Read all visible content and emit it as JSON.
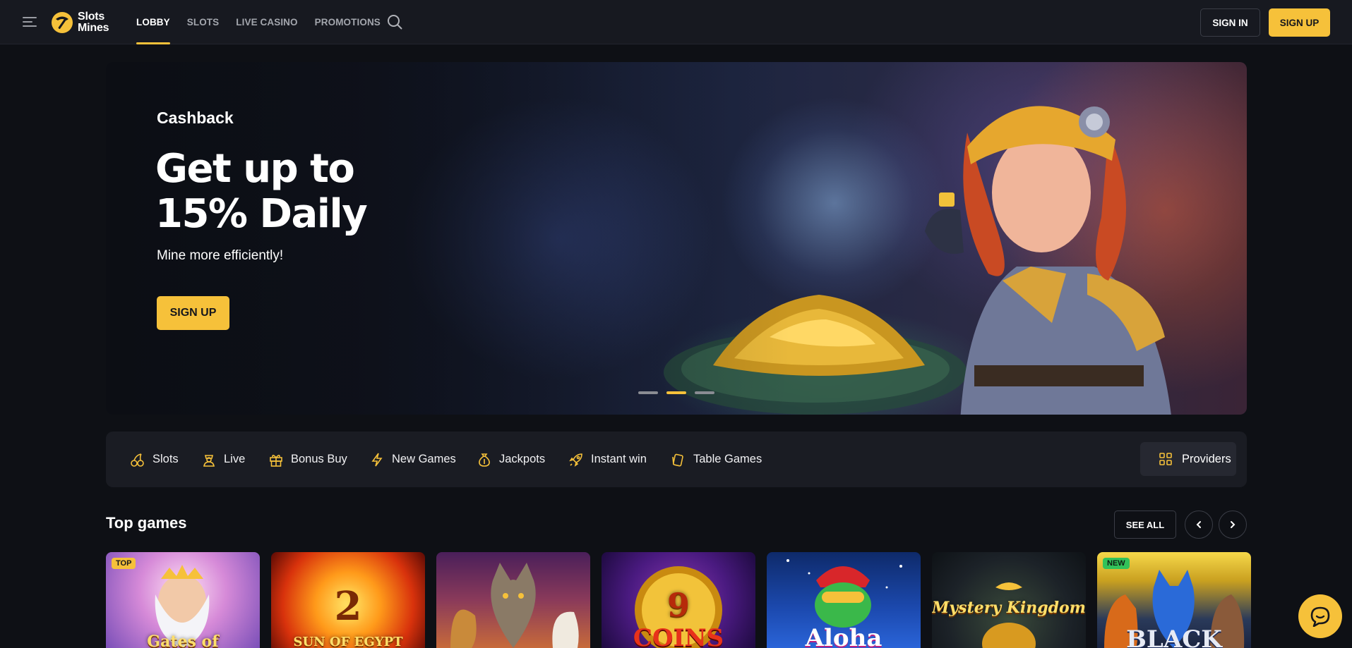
{
  "header": {
    "logo_line1": "Slots",
    "logo_line2": "Mines",
    "nav": [
      "LOBBY",
      "SLOTS",
      "LIVE CASINO",
      "PROMOTIONS"
    ],
    "sign_in": "SIGN IN",
    "sign_up": "SIGN UP"
  },
  "hero": {
    "eyebrow": "Cashback",
    "title_line1": "Get up to",
    "title_line2": "15% Daily",
    "subtitle": "Mine more efficiently!",
    "cta": "SIGN UP",
    "slides": 3,
    "active_slide": 2
  },
  "categories": [
    {
      "label": "Slots",
      "icon": "cherries-icon"
    },
    {
      "label": "Live",
      "icon": "dealer-icon"
    },
    {
      "label": "Bonus Buy",
      "icon": "gift-icon"
    },
    {
      "label": "New Games",
      "icon": "lightning-icon"
    },
    {
      "label": "Jackpots",
      "icon": "money-bag-icon"
    },
    {
      "label": "Instant win",
      "icon": "rocket-icon"
    },
    {
      "label": "Table Games",
      "icon": "cards-icon"
    }
  ],
  "providers_label": "Providers",
  "section": {
    "title": "Top games",
    "see_all": "SEE ALL"
  },
  "games": [
    {
      "name": "Gates of",
      "badge": "TOP"
    },
    {
      "name": "SUN OF EGYPT",
      "badge": ""
    },
    {
      "name": "",
      "badge": ""
    },
    {
      "name": "COINS",
      "badge": ""
    },
    {
      "name": "Aloha",
      "badge": ""
    },
    {
      "name": "Mystery Kingdom",
      "badge": ""
    },
    {
      "name": "BLACK",
      "badge": "NEW"
    }
  ],
  "colors": {
    "accent": "#f6c13a",
    "background": "#0e1015",
    "header_bg": "#171920",
    "panel_bg": "#1a1c23",
    "new_badge": "#32c25a"
  }
}
